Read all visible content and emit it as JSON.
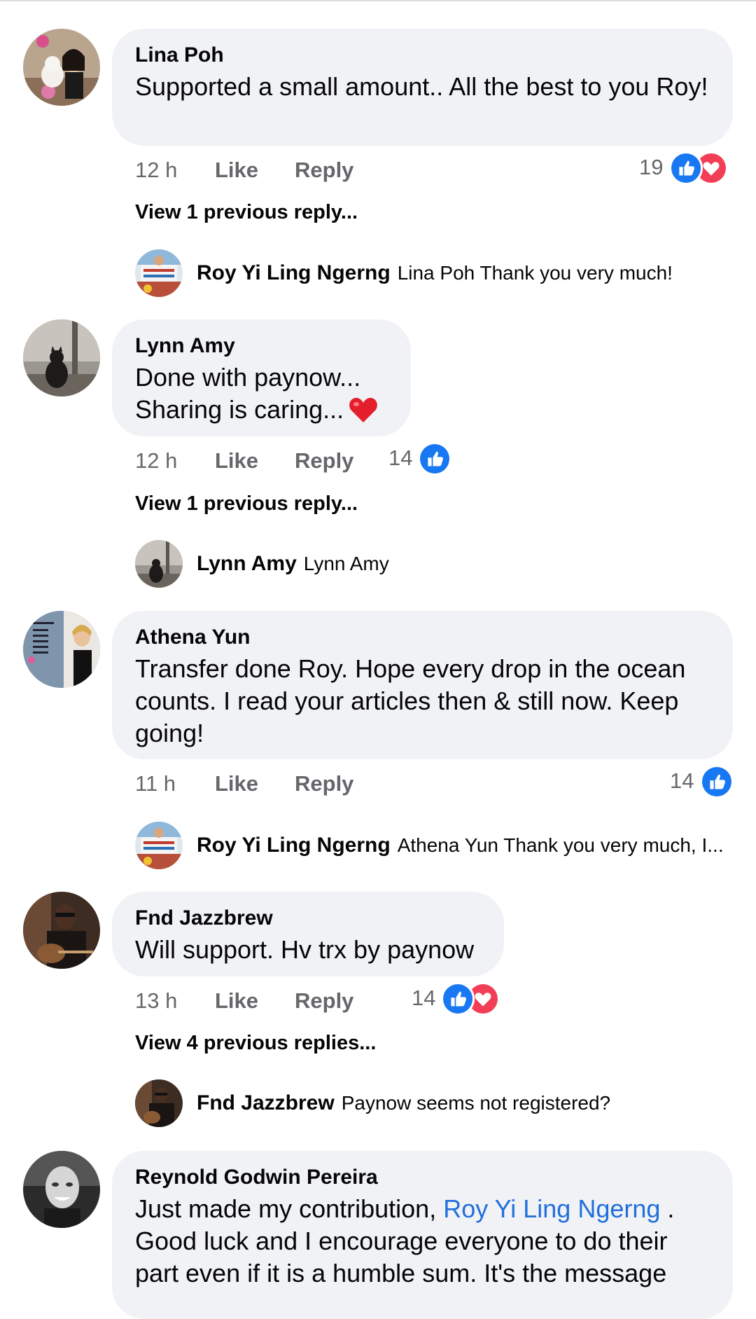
{
  "comments": [
    {
      "author": "Lina Poh",
      "text": "Supported a small amount.. All the best to you Roy!",
      "time": "12 h",
      "like_label": "Like",
      "reply_label": "Reply",
      "reaction_count": "19",
      "reactions": [
        "like-icon",
        "love-icon"
      ],
      "view_previous": "View 1 previous reply...",
      "reply": {
        "author": "Roy Yi Ling Ngerng",
        "text": "Lina Poh Thank you very much!"
      }
    },
    {
      "author": "Lynn Amy",
      "text_line1": "Done with paynow...",
      "text_line2": "Sharing is caring...",
      "emoji": "heart-emoji",
      "time": "12 h",
      "like_label": "Like",
      "reply_label": "Reply",
      "reaction_count": "14",
      "reactions": [
        "like-icon"
      ],
      "view_previous": "View 1 previous reply...",
      "reply": {
        "author": "Lynn Amy",
        "text": "Lynn Amy"
      }
    },
    {
      "author": "Athena Yun",
      "text": "Transfer done Roy. Hope every drop in the ocean counts. I read your articles then & still now. Keep going!",
      "time": "11 h",
      "like_label": "Like",
      "reply_label": "Reply",
      "reaction_count": "14",
      "reactions": [
        "like-icon"
      ],
      "reply": {
        "author": "Roy Yi Ling Ngerng",
        "text": "Athena Yun Thank you very much, I..."
      }
    },
    {
      "author": "Fnd Jazzbrew",
      "text": "Will support. Hv trx by paynow",
      "time": "13 h",
      "like_label": "Like",
      "reply_label": "Reply",
      "reaction_count": "14",
      "reactions": [
        "like-icon",
        "love-icon"
      ],
      "view_previous": "View 4 previous replies...",
      "reply": {
        "author": "Fnd Jazzbrew",
        "text": "Paynow seems not registered?"
      }
    },
    {
      "author": "Reynold Godwin Pereira",
      "text_before": "Just made my contribution, ",
      "mention": "Roy Yi Ling Ngerng",
      "text_after": " . Good luck and I encourage everyone to do their part even if it is a humble sum. It's the message"
    }
  ],
  "colors": {
    "like_blue": "#1877f2",
    "love_red": "#f33e58",
    "bubble": "#f0f2f5",
    "mention": "#216fdb"
  }
}
